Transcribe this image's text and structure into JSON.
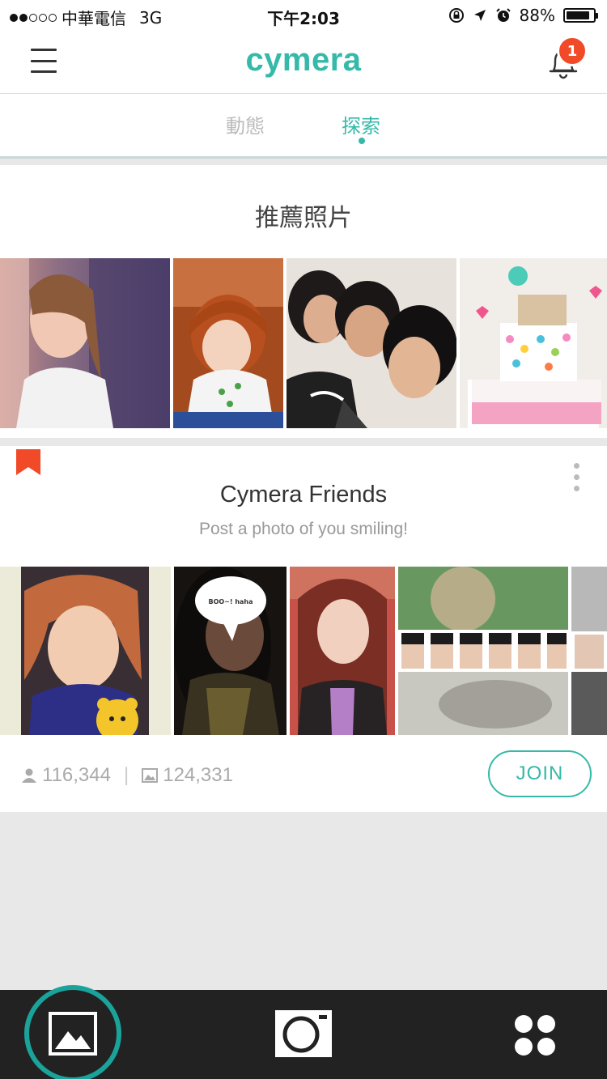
{
  "status_bar": {
    "carrier": "中華電信",
    "network": "3G",
    "time": "下午2:03",
    "battery_percent": "88%",
    "battery_level": 0.88
  },
  "header": {
    "menu_icon": "hamburger-menu-icon",
    "logo_text": "cymera",
    "bell_icon": "notification-bell-icon",
    "notification_count": "1"
  },
  "tabs": [
    {
      "label": "動態",
      "active": false
    },
    {
      "label": "探索",
      "active": true
    }
  ],
  "recommended": {
    "title": "推薦照片",
    "photos": [
      "girl-selfie-photo",
      "baby-photo",
      "three-friends-photo",
      "birthday-cake-photo"
    ]
  },
  "group": {
    "name": "Cymera Friends",
    "description": "Post a photo of you smiling!",
    "photos": [
      "red-hair-girl-photo",
      "speech-bubble-photo",
      "long-hair-girl-photo",
      "collage-photo",
      "partial-photo"
    ],
    "speech_bubble_text": "BOO~! haha",
    "members_count": "116,344",
    "photos_count": "124,331",
    "join_label": "JOIN"
  },
  "bottom_nav": {
    "items": [
      "gallery-icon",
      "camera-icon",
      "apps-grid-icon"
    ],
    "active": "gallery-icon"
  },
  "colors": {
    "accent": "#35b9a8",
    "badge": "#f04a28",
    "nav_bg": "#222222",
    "bookmark": "#f04a28"
  }
}
